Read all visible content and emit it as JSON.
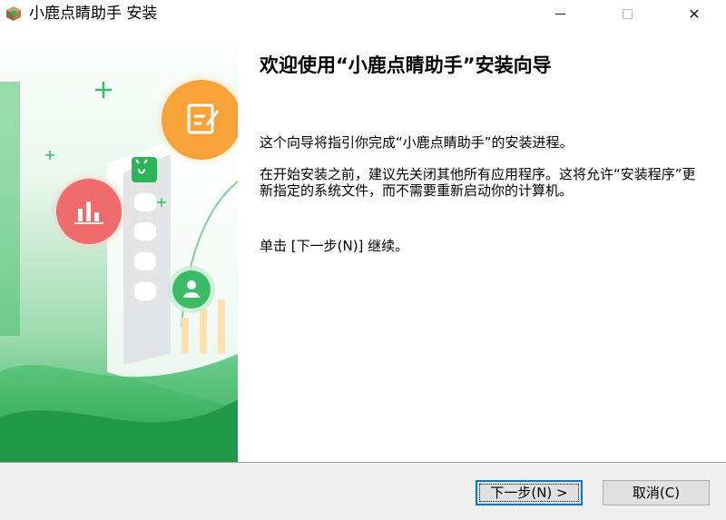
{
  "window": {
    "title": "小鹿点睛助手 安装",
    "app_icon": "installer-package-icon",
    "controls": {
      "minimize": "minimize-icon",
      "maximize": "maximize-icon",
      "close": "close-icon"
    },
    "close_glyph": "✕"
  },
  "content": {
    "heading": "欢迎使用“小鹿点睛助手”安装向导",
    "paragraph1": "这个向导将指引你完成“小鹿点睛助手”的安装进程。",
    "paragraph2": "在开始安装之前，建议先关闭其他所有应用程序。这将允许“安装程序”更新指定的系统文件，而不需要重新启动你的计算机。",
    "paragraph3": "单击 [下一步(N)] 继续。"
  },
  "buttons": {
    "next": "下一步(N) >",
    "cancel": "取消(C)"
  },
  "sidebar": {
    "icons": [
      "edit-note-icon",
      "bar-chart-icon",
      "user-icon",
      "deer-logo-icon",
      "plus-icon"
    ]
  },
  "colors": {
    "brand_green": "#2eb35a",
    "orange": "#f7a33a",
    "coral": "#f06b6b",
    "focus_blue": "#0078d7"
  }
}
